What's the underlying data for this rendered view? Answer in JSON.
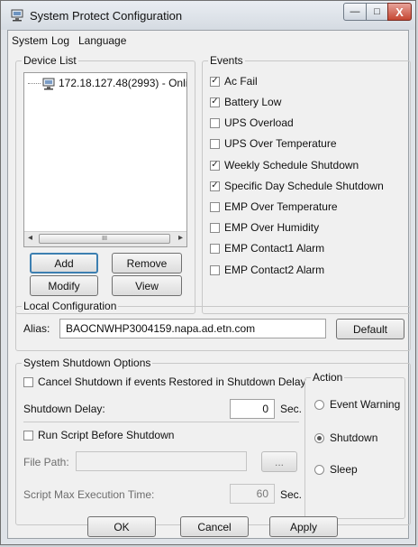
{
  "window": {
    "title": "System Protect Configuration",
    "minimize_label": "—",
    "maximize_label": "□",
    "close_label": "X"
  },
  "menu": [
    "System",
    "Log",
    "Language"
  ],
  "device_list": {
    "label": "Device List",
    "item": "172.18.127.48(2993) - Onlin",
    "scroll_thumb_label": "III",
    "scroll_left": "◂",
    "scroll_right": "▸"
  },
  "device_buttons": {
    "add": "Add",
    "remove": "Remove",
    "modify": "Modify",
    "view": "View"
  },
  "events": {
    "label": "Events",
    "items": [
      {
        "label": "Ac Fail",
        "checked": true
      },
      {
        "label": "Battery Low",
        "checked": true
      },
      {
        "label": "UPS Overload",
        "checked": false
      },
      {
        "label": "UPS Over Temperature",
        "checked": false
      },
      {
        "label": "Weekly Schedule Shutdown",
        "checked": true
      },
      {
        "label": "Specific Day Schedule Shutdown",
        "checked": true
      },
      {
        "label": "EMP Over Temperature",
        "checked": false
      },
      {
        "label": "EMP Over Humidity",
        "checked": false
      },
      {
        "label": "EMP Contact1 Alarm",
        "checked": false
      },
      {
        "label": "EMP Contact2 Alarm",
        "checked": false
      }
    ]
  },
  "local_config": {
    "label": "Local Configuration",
    "alias_label": "Alias:",
    "alias_value": "BAOCNWHP3004159.napa.ad.etn.com",
    "default_button": "Default"
  },
  "shutdown": {
    "label": "System Shutdown Options",
    "cancel_if_restored": {
      "label": "Cancel Shutdown if events Restored in Shutdown Delay",
      "checked": false
    },
    "delay_label": "Shutdown Delay:",
    "delay_value": "0",
    "delay_unit": "Sec.",
    "run_script": {
      "label": "Run Script Before Shutdown",
      "checked": false
    },
    "file_path_label": "File Path:",
    "file_path_value": "",
    "browse_label": "...",
    "max_exec_label": "Script Max Execution Time:",
    "max_exec_value": "60",
    "max_exec_unit": "Sec."
  },
  "action": {
    "label": "Action",
    "options": [
      {
        "label": "Event Warning",
        "selected": false
      },
      {
        "label": "Shutdown",
        "selected": true
      },
      {
        "label": "Sleep",
        "selected": false
      }
    ]
  },
  "footer": {
    "ok": "OK",
    "cancel": "Cancel",
    "apply": "Apply"
  },
  "icons": {
    "app": "network-computer-icon",
    "device": "computer-node-icon",
    "check": "✓"
  }
}
